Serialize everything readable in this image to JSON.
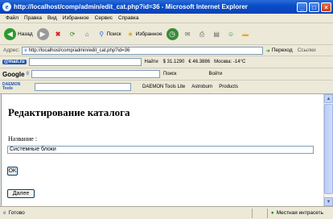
{
  "window": {
    "title": "http://localhost/comp/admin/edit_cat.php?id=36 - Microsoft Internet Explorer"
  },
  "menu": [
    "Файл",
    "Правка",
    "Вид",
    "Избранное",
    "Сервис",
    "Справка"
  ],
  "toolbar": {
    "back": "Назад",
    "search": "Поиск",
    "favorites": "Избранное"
  },
  "address": {
    "label": "Адрес:",
    "url": "http://localhost/comp/admin/edit_cat.php?id=36",
    "go": "Переход",
    "links": "Ссылки"
  },
  "mailru": {
    "logo": "@mail.ru",
    "find": "Найти",
    "usd": "$ 31.1290",
    "eur": "€ 46.3886",
    "weather": "Москва: -14°C"
  },
  "google": {
    "logo": "Google",
    "g": "8",
    "search": "Поиск",
    "settings": "Войти"
  },
  "daemon": {
    "logo": "DAEMON Tools",
    "daemon_lite": "DAEMON Tools Lite",
    "astroburn": "Astroburn",
    "products": "Products"
  },
  "page": {
    "title": "Редактирование каталога",
    "field_label": "Название :",
    "field_value": "Системные блоки",
    "ok_button": "OK",
    "back_button": "Далее"
  },
  "status": {
    "done": "Готово",
    "zone": "Местная интрасеть"
  }
}
